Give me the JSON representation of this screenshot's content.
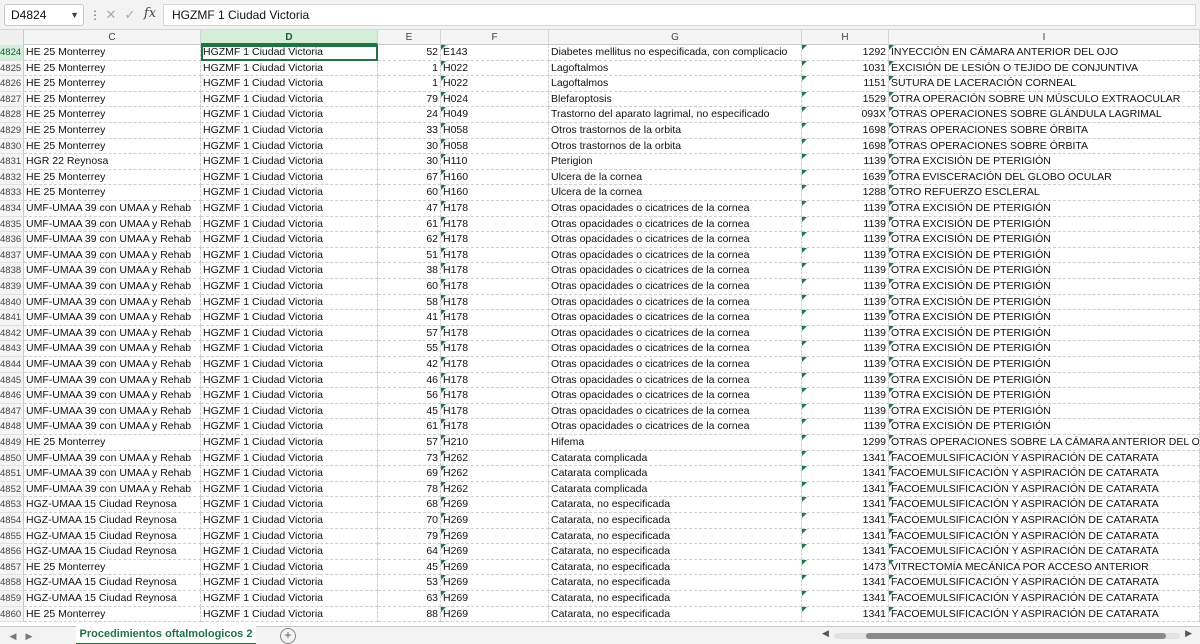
{
  "formula_bar": {
    "name_box": "D4824",
    "formula": "HGZMF 1 Ciudad Victoria"
  },
  "icons": {
    "dropdown": "chevron-down-icon",
    "more": "kebab-icon",
    "cancel": "close-icon",
    "enter": "check-icon",
    "function": "fx-icon",
    "add_sheet": "plus-circle-icon"
  },
  "columns": [
    "C",
    "D",
    "E",
    "F",
    "G",
    "H",
    "I"
  ],
  "active_column": "D",
  "active_row": "4824",
  "rows": [
    {
      "n": "4824",
      "C": "HE 25 Monterrey",
      "D": "HGZMF 1 Ciudad Victoria",
      "E": "52",
      "F": "E143",
      "G": "Diabetes mellitus no especificada, con complicacio",
      "H": "1292",
      "I": "INYECCIÓN EN CÁMARA ANTERIOR DEL OJO"
    },
    {
      "n": "4825",
      "C": "HE 25 Monterrey",
      "D": "HGZMF 1 Ciudad Victoria",
      "E": "1",
      "F": "H022",
      "G": "Lagoftalmos",
      "H": "1031",
      "I": "EXCISIÓN DE LESIÓN O TEJIDO DE CONJUNTIVA"
    },
    {
      "n": "4826",
      "C": "HE 25 Monterrey",
      "D": "HGZMF 1 Ciudad Victoria",
      "E": "1",
      "F": "H022",
      "G": "Lagoftalmos",
      "H": "1151",
      "I": "SUTURA DE LACERACIÓN CORNEAL"
    },
    {
      "n": "4827",
      "C": "HE 25 Monterrey",
      "D": "HGZMF 1 Ciudad Victoria",
      "E": "79",
      "F": "H024",
      "G": "Blefaroptosis",
      "H": "1529",
      "I": "OTRA OPERACIÓN SOBRE UN MÚSCULO EXTRAOCULAR"
    },
    {
      "n": "4828",
      "C": "HE 25 Monterrey",
      "D": "HGZMF 1 Ciudad Victoria",
      "E": "24",
      "F": "H049",
      "G": "Trastorno del aparato lagrimal, no especificado",
      "H": "093X",
      "I": "OTRAS OPERACIONES SOBRE GLÁNDULA LAGRIMAL"
    },
    {
      "n": "4829",
      "C": "HE 25 Monterrey",
      "D": "HGZMF 1 Ciudad Victoria",
      "E": "33",
      "F": "H058",
      "G": "Otros trastornos de la orbita",
      "H": "1698",
      "I": "OTRAS OPERACIONES SOBRE ÓRBITA"
    },
    {
      "n": "4830",
      "C": "HE 25 Monterrey",
      "D": "HGZMF 1 Ciudad Victoria",
      "E": "30",
      "F": "H058",
      "G": "Otros trastornos de la orbita",
      "H": "1698",
      "I": "OTRAS OPERACIONES SOBRE ÓRBITA"
    },
    {
      "n": "4831",
      "C": "HGR 22 Reynosa",
      "D": "HGZMF 1 Ciudad Victoria",
      "E": "30",
      "F": "H110",
      "G": "Pterigion",
      "H": "1139",
      "I": "OTRA EXCISIÓN DE PTERIGIÓN"
    },
    {
      "n": "4832",
      "C": "HE 25 Monterrey",
      "D": "HGZMF 1 Ciudad Victoria",
      "E": "67",
      "F": "H160",
      "G": "Ulcera de la cornea",
      "H": "1639",
      "I": "OTRA EVISCERACIÓN DEL GLOBO OCULAR"
    },
    {
      "n": "4833",
      "C": "HE 25 Monterrey",
      "D": "HGZMF 1 Ciudad Victoria",
      "E": "60",
      "F": "H160",
      "G": "Ulcera de la cornea",
      "H": "1288",
      "I": "OTRO REFUERZO ESCLERAL"
    },
    {
      "n": "4834",
      "C": "UMF-UMAA 39 con UMAA y Rehab",
      "D": "HGZMF 1 Ciudad Victoria",
      "E": "47",
      "F": "H178",
      "G": "Otras opacidades o cicatrices de la cornea",
      "H": "1139",
      "I": "OTRA EXCISIÓN DE PTERIGIÓN"
    },
    {
      "n": "4835",
      "C": "UMF-UMAA 39 con UMAA y Rehab",
      "D": "HGZMF 1 Ciudad Victoria",
      "E": "61",
      "F": "H178",
      "G": "Otras opacidades o cicatrices de la cornea",
      "H": "1139",
      "I": "OTRA EXCISIÓN DE PTERIGIÓN"
    },
    {
      "n": "4836",
      "C": "UMF-UMAA 39 con UMAA y Rehab",
      "D": "HGZMF 1 Ciudad Victoria",
      "E": "62",
      "F": "H178",
      "G": "Otras opacidades o cicatrices de la cornea",
      "H": "1139",
      "I": "OTRA EXCISIÓN DE PTERIGIÓN"
    },
    {
      "n": "4837",
      "C": "UMF-UMAA 39 con UMAA y Rehab",
      "D": "HGZMF 1 Ciudad Victoria",
      "E": "51",
      "F": "H178",
      "G": "Otras opacidades o cicatrices de la cornea",
      "H": "1139",
      "I": "OTRA EXCISIÓN DE PTERIGIÓN"
    },
    {
      "n": "4838",
      "C": "UMF-UMAA 39 con UMAA y Rehab",
      "D": "HGZMF 1 Ciudad Victoria",
      "E": "38",
      "F": "H178",
      "G": "Otras opacidades o cicatrices de la cornea",
      "H": "1139",
      "I": "OTRA EXCISIÓN DE PTERIGIÓN"
    },
    {
      "n": "4839",
      "C": "UMF-UMAA 39 con UMAA y Rehab",
      "D": "HGZMF 1 Ciudad Victoria",
      "E": "60",
      "F": "H178",
      "G": "Otras opacidades o cicatrices de la cornea",
      "H": "1139",
      "I": "OTRA EXCISIÓN DE PTERIGIÓN"
    },
    {
      "n": "4840",
      "C": "UMF-UMAA 39 con UMAA y Rehab",
      "D": "HGZMF 1 Ciudad Victoria",
      "E": "58",
      "F": "H178",
      "G": "Otras opacidades o cicatrices de la cornea",
      "H": "1139",
      "I": "OTRA EXCISIÓN DE PTERIGIÓN"
    },
    {
      "n": "4841",
      "C": "UMF-UMAA 39 con UMAA y Rehab",
      "D": "HGZMF 1 Ciudad Victoria",
      "E": "41",
      "F": "H178",
      "G": "Otras opacidades o cicatrices de la cornea",
      "H": "1139",
      "I": "OTRA EXCISIÓN DE PTERIGIÓN"
    },
    {
      "n": "4842",
      "C": "UMF-UMAA 39 con UMAA y Rehab",
      "D": "HGZMF 1 Ciudad Victoria",
      "E": "57",
      "F": "H178",
      "G": "Otras opacidades o cicatrices de la cornea",
      "H": "1139",
      "I": "OTRA EXCISIÓN DE PTERIGIÓN"
    },
    {
      "n": "4843",
      "C": "UMF-UMAA 39 con UMAA y Rehab",
      "D": "HGZMF 1 Ciudad Victoria",
      "E": "55",
      "F": "H178",
      "G": "Otras opacidades o cicatrices de la cornea",
      "H": "1139",
      "I": "OTRA EXCISIÓN DE PTERIGIÓN"
    },
    {
      "n": "4844",
      "C": "UMF-UMAA 39 con UMAA y Rehab",
      "D": "HGZMF 1 Ciudad Victoria",
      "E": "42",
      "F": "H178",
      "G": "Otras opacidades o cicatrices de la cornea",
      "H": "1139",
      "I": "OTRA EXCISIÓN DE PTERIGIÓN"
    },
    {
      "n": "4845",
      "C": "UMF-UMAA 39 con UMAA y Rehab",
      "D": "HGZMF 1 Ciudad Victoria",
      "E": "46",
      "F": "H178",
      "G": "Otras opacidades o cicatrices de la cornea",
      "H": "1139",
      "I": "OTRA EXCISIÓN DE PTERIGIÓN"
    },
    {
      "n": "4846",
      "C": "UMF-UMAA 39 con UMAA y Rehab",
      "D": "HGZMF 1 Ciudad Victoria",
      "E": "56",
      "F": "H178",
      "G": "Otras opacidades o cicatrices de la cornea",
      "H": "1139",
      "I": "OTRA EXCISIÓN DE PTERIGIÓN"
    },
    {
      "n": "4847",
      "C": "UMF-UMAA 39 con UMAA y Rehab",
      "D": "HGZMF 1 Ciudad Victoria",
      "E": "45",
      "F": "H178",
      "G": "Otras opacidades o cicatrices de la cornea",
      "H": "1139",
      "I": "OTRA EXCISIÓN DE PTERIGIÓN"
    },
    {
      "n": "4848",
      "C": "UMF-UMAA 39 con UMAA y Rehab",
      "D": "HGZMF 1 Ciudad Victoria",
      "E": "61",
      "F": "H178",
      "G": "Otras opacidades o cicatrices de la cornea",
      "H": "1139",
      "I": "OTRA EXCISIÓN DE PTERIGIÓN"
    },
    {
      "n": "4849",
      "C": "HE 25 Monterrey",
      "D": "HGZMF 1 Ciudad Victoria",
      "E": "57",
      "F": "H210",
      "G": "Hifema",
      "H": "1299",
      "I": "OTRAS OPERACIONES SOBRE LA CÁMARA ANTERIOR DEL OJO"
    },
    {
      "n": "4850",
      "C": "UMF-UMAA 39 con UMAA y Rehab",
      "D": "HGZMF 1 Ciudad Victoria",
      "E": "73",
      "F": "H262",
      "G": "Catarata complicada",
      "H": "1341",
      "I": "FACOEMULSIFICACIÓN Y ASPIRACIÓN DE CATARATA"
    },
    {
      "n": "4851",
      "C": "UMF-UMAA 39 con UMAA y Rehab",
      "D": "HGZMF 1 Ciudad Victoria",
      "E": "69",
      "F": "H262",
      "G": "Catarata complicada",
      "H": "1341",
      "I": "FACOEMULSIFICACIÓN Y ASPIRACIÓN DE CATARATA"
    },
    {
      "n": "4852",
      "C": "UMF-UMAA 39 con UMAA y Rehab",
      "D": "HGZMF 1 Ciudad Victoria",
      "E": "78",
      "F": "H262",
      "G": "Catarata complicada",
      "H": "1341",
      "I": "FACOEMULSIFICACIÓN Y ASPIRACIÓN DE CATARATA"
    },
    {
      "n": "4853",
      "C": "HGZ-UMAA 15 Ciudad Reynosa",
      "D": "HGZMF 1 Ciudad Victoria",
      "E": "68",
      "F": "H269",
      "G": "Catarata, no especificada",
      "H": "1341",
      "I": "FACOEMULSIFICACIÓN Y ASPIRACIÓN DE CATARATA"
    },
    {
      "n": "4854",
      "C": "HGZ-UMAA 15 Ciudad Reynosa",
      "D": "HGZMF 1 Ciudad Victoria",
      "E": "70",
      "F": "H269",
      "G": "Catarata, no especificada",
      "H": "1341",
      "I": "FACOEMULSIFICACIÓN Y ASPIRACIÓN DE CATARATA"
    },
    {
      "n": "4855",
      "C": "HGZ-UMAA 15 Ciudad Reynosa",
      "D": "HGZMF 1 Ciudad Victoria",
      "E": "79",
      "F": "H269",
      "G": "Catarata, no especificada",
      "H": "1341",
      "I": "FACOEMULSIFICACIÓN Y ASPIRACIÓN DE CATARATA"
    },
    {
      "n": "4856",
      "C": "HGZ-UMAA 15 Ciudad Reynosa",
      "D": "HGZMF 1 Ciudad Victoria",
      "E": "64",
      "F": "H269",
      "G": "Catarata, no especificada",
      "H": "1341",
      "I": "FACOEMULSIFICACIÓN Y ASPIRACIÓN DE CATARATA"
    },
    {
      "n": "4857",
      "C": "HE 25 Monterrey",
      "D": "HGZMF 1 Ciudad Victoria",
      "E": "45",
      "F": "H269",
      "G": "Catarata, no especificada",
      "H": "1473",
      "I": "VITRECTOMÍA MECÁNICA POR ACCESO ANTERIOR"
    },
    {
      "n": "4858",
      "C": "HGZ-UMAA 15 Ciudad Reynosa",
      "D": "HGZMF 1 Ciudad Victoria",
      "E": "53",
      "F": "H269",
      "G": "Catarata, no especificada",
      "H": "1341",
      "I": "FACOEMULSIFICACIÓN Y ASPIRACIÓN DE CATARATA"
    },
    {
      "n": "4859",
      "C": "HGZ-UMAA 15 Ciudad Reynosa",
      "D": "HGZMF 1 Ciudad Victoria",
      "E": "63",
      "F": "H269",
      "G": "Catarata, no especificada",
      "H": "1341",
      "I": "FACOEMULSIFICACIÓN Y ASPIRACIÓN DE CATARATA"
    },
    {
      "n": "4860",
      "C": "HE 25 Monterrey",
      "D": "HGZMF 1 Ciudad Victoria",
      "E": "88",
      "F": "H269",
      "G": "Catarata, no especificada",
      "H": "1341",
      "I": "FACOEMULSIFICACIÓN Y ASPIRACIÓN DE CATARATA"
    }
  ],
  "sheet_tabs": {
    "prev": "◀",
    "next": "▶",
    "active": "Procedimientos oftalmologicos 2",
    "add": "+"
  },
  "scroll": {
    "left": "◀",
    "right": "▶"
  },
  "colors": {
    "accent": "#217346",
    "header_active_bg": "#d3eed9"
  }
}
